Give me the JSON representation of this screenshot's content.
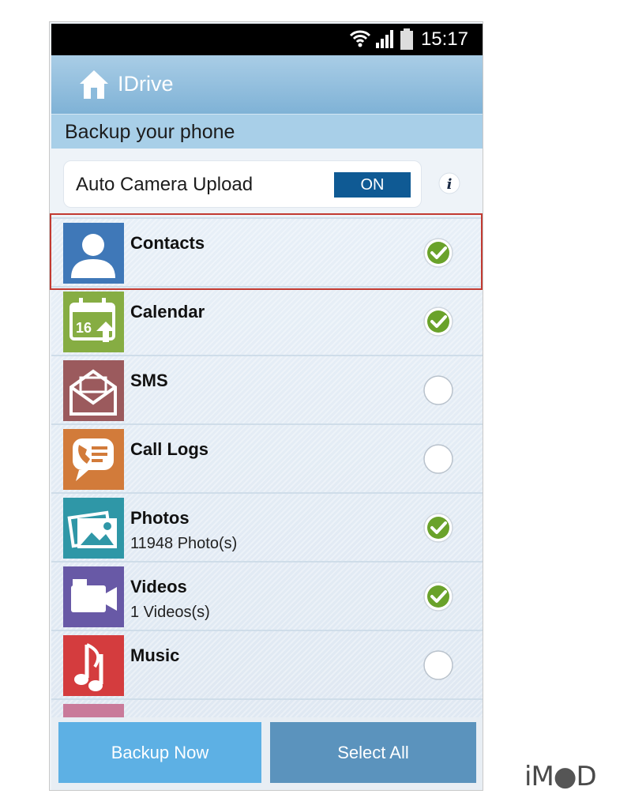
{
  "status_bar": {
    "time": "15:17"
  },
  "app_bar": {
    "title": "IDrive"
  },
  "section": {
    "title": "Backup your phone"
  },
  "auto_upload": {
    "label": "Auto Camera Upload",
    "toggle_state": "ON"
  },
  "items": [
    {
      "title": "Contacts",
      "subtitle": "",
      "checked": true,
      "icon": "contacts-icon",
      "color": "#3f78b8"
    },
    {
      "title": "Calendar",
      "subtitle": "",
      "checked": true,
      "icon": "calendar-icon",
      "color": "#86ad43",
      "icon_text": "16"
    },
    {
      "title": "SMS",
      "subtitle": "",
      "checked": false,
      "icon": "sms-icon",
      "color": "#9b5a5d"
    },
    {
      "title": "Call Logs",
      "subtitle": "",
      "checked": false,
      "icon": "call-logs-icon",
      "color": "#d27b3a"
    },
    {
      "title": "Photos",
      "subtitle": "11948 Photo(s)",
      "checked": true,
      "icon": "photos-icon",
      "color": "#2f97a7"
    },
    {
      "title": "Videos",
      "subtitle": "1 Videos(s)",
      "checked": true,
      "icon": "videos-icon",
      "color": "#6859a6"
    },
    {
      "title": "Music",
      "subtitle": "",
      "checked": false,
      "icon": "music-icon",
      "color": "#d43c3e"
    }
  ],
  "buttons": {
    "backup_now": "Backup Now",
    "select_all": "Select All"
  },
  "watermark": {
    "text_pre": "iM",
    "text_post": "D"
  },
  "colors": {
    "accent": "#0f5a94",
    "check_green": "#6aa22a",
    "highlight": "#c23a31"
  }
}
